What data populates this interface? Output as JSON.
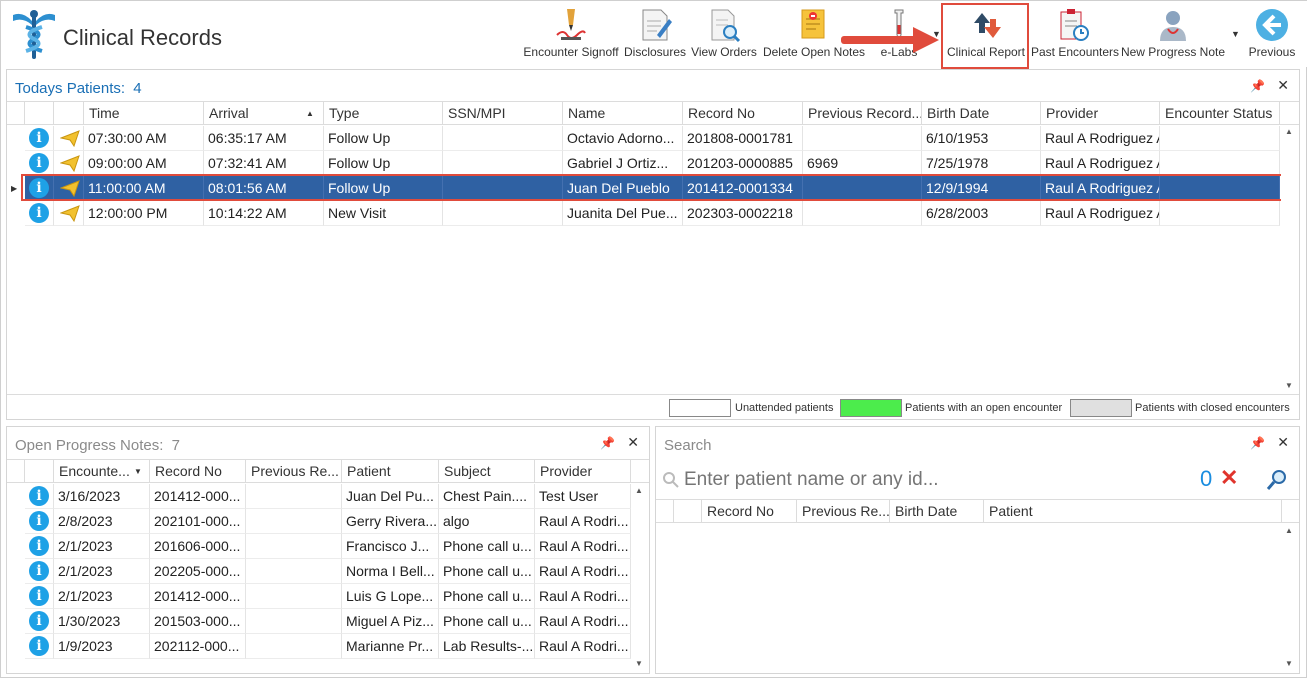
{
  "header": {
    "title": "Clinical Records",
    "toolbar": [
      {
        "label": "Encounter Signoff",
        "icon": "signature-pen-icon"
      },
      {
        "label": "Disclosures",
        "icon": "document-edit-icon"
      },
      {
        "label": "View Orders",
        "icon": "document-search-icon"
      },
      {
        "label": "Delete Open Notes",
        "icon": "notes-delete-icon"
      },
      {
        "label": "e-Labs",
        "icon": "test-tube-icon"
      },
      {
        "label": "Clinical Report",
        "icon": "report-arrows-icon"
      },
      {
        "label": "Past Encounters",
        "icon": "clipboard-clock-icon"
      },
      {
        "label": "New Progress Note",
        "icon": "doctor-note-icon"
      },
      {
        "label": "Previous",
        "icon": "back-arrow-icon"
      }
    ]
  },
  "todays": {
    "title": "Todays Patients:",
    "count": "4",
    "columns": [
      "Time",
      "Arrival",
      "Type",
      "SSN/MPI",
      "Name",
      "Record No",
      "Previous Record...",
      "Birth Date",
      "Provider",
      "Encounter Status"
    ],
    "rows": [
      {
        "time": "07:30:00 AM",
        "arrival": "06:35:17 AM",
        "type": "Follow Up",
        "ssn": "",
        "name": "Octavio Adorno...",
        "record": "201808-0001781",
        "prev": "",
        "birth": "6/10/1953",
        "provider": "Raul A Rodriguez A",
        "status": ""
      },
      {
        "time": "09:00:00 AM",
        "arrival": "07:32:41 AM",
        "type": "Follow Up",
        "ssn": "",
        "name": "Gabriel J Ortiz...",
        "record": "201203-0000885",
        "prev": "6969",
        "birth": "7/25/1978",
        "provider": "Raul A Rodriguez A",
        "status": ""
      },
      {
        "time": "11:00:00 AM",
        "arrival": "08:01:56 AM",
        "type": "Follow Up",
        "ssn": "",
        "name": "Juan Del Pueblo",
        "record": "201412-0001334",
        "prev": "",
        "birth": "12/9/1994",
        "provider": "Raul A Rodriguez A",
        "status": ""
      },
      {
        "time": "12:00:00 PM",
        "arrival": "10:14:22 AM",
        "type": "New Visit",
        "ssn": "",
        "name": "Juanita Del Pue...",
        "record": "202303-0002218",
        "prev": "",
        "birth": "6/28/2003",
        "provider": "Raul A Rodriguez A",
        "status": ""
      }
    ],
    "legend": {
      "unattended": "Unattended patients",
      "open": "Patients with an open encounter",
      "closed": "Patients with closed encounters",
      "open_color": "#4cec4c",
      "closed_color": "#e0e0e0"
    }
  },
  "notes": {
    "title": "Open Progress Notes:",
    "count": "7",
    "columns": [
      "Encounte...",
      "Record No",
      "Previous Re...",
      "Patient",
      "Subject",
      "Provider"
    ],
    "rows": [
      {
        "date": "3/16/2023",
        "record": "201412-000...",
        "prev": "",
        "patient": "Juan Del Pu...",
        "subject": "Chest Pain....",
        "provider": "Test User"
      },
      {
        "date": "2/8/2023",
        "record": "202101-000...",
        "prev": "",
        "patient": "Gerry Rivera...",
        "subject": "algo",
        "provider": "Raul A Rodri..."
      },
      {
        "date": "2/1/2023",
        "record": "201606-000...",
        "prev": "",
        "patient": "Francisco J...",
        "subject": "Phone call u...",
        "provider": "Raul A Rodri..."
      },
      {
        "date": "2/1/2023",
        "record": "202205-000...",
        "prev": "",
        "patient": "Norma I Bell...",
        "subject": "Phone call u...",
        "provider": "Raul A Rodri..."
      },
      {
        "date": "2/1/2023",
        "record": "201412-000...",
        "prev": "",
        "patient": "Luis G Lope...",
        "subject": "Phone call u...",
        "provider": "Raul A Rodri..."
      },
      {
        "date": "1/30/2023",
        "record": "201503-000...",
        "prev": "",
        "patient": "Miguel A Piz...",
        "subject": "Phone call u...",
        "provider": "Raul A Rodri..."
      },
      {
        "date": "1/9/2023",
        "record": "202112-000...",
        "prev": "",
        "patient": "Marianne Pr...",
        "subject": "Lab Results-...",
        "provider": "Raul A Rodri..."
      }
    ]
  },
  "search": {
    "title": "Search",
    "placeholder": "Enter patient name or any id...",
    "count": "0",
    "columns": [
      "Record No",
      "Previous Re...",
      "Birth Date",
      "Patient"
    ]
  },
  "colors": {
    "accent": "#1a6fb5",
    "selection": "#2f61a3",
    "highlight": "#e04b3c",
    "info": "#1ea1e6"
  }
}
